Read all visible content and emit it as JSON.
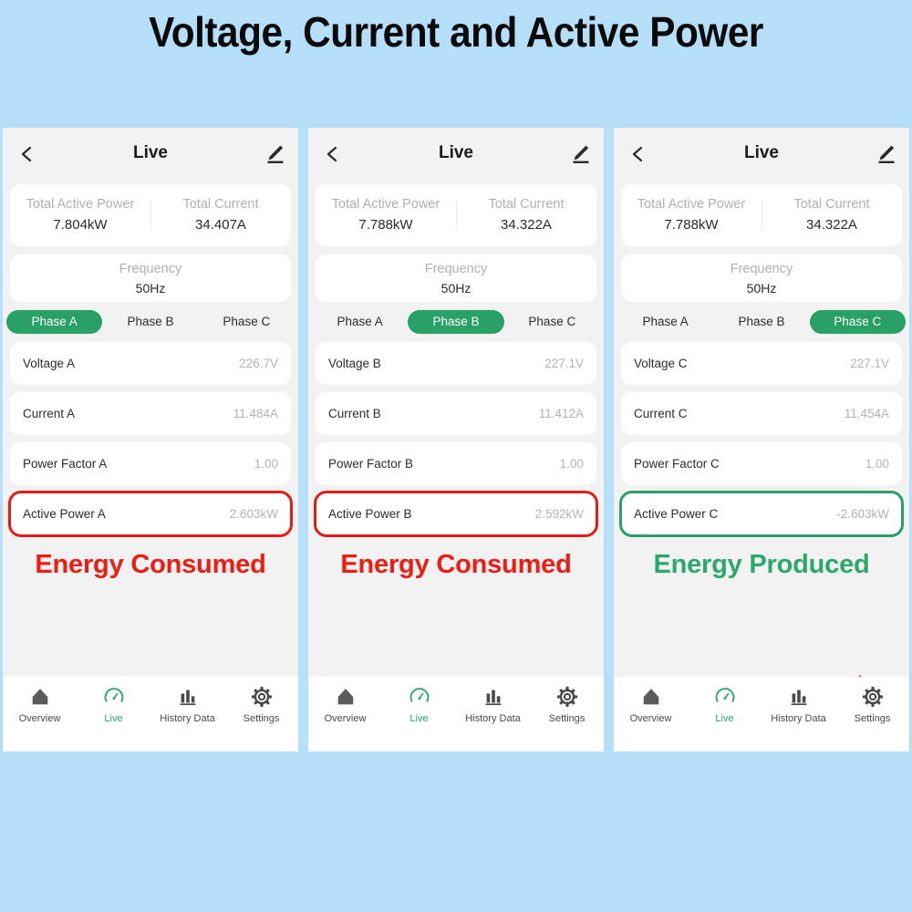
{
  "page": {
    "title": "Voltage, Current and Active Power",
    "background_color": "#b5dff8",
    "accent_green": "#28a066",
    "accent_red": "#e51b15"
  },
  "panels": [
    {
      "header": {
        "title": "Live",
        "back_icon": "chevron-left-icon",
        "edit_icon": "pencil-edit-icon"
      },
      "summary": {
        "total_active_power_label": "Total Active Power",
        "total_active_power_value": "7.804kW",
        "total_current_label": "Total Current",
        "total_current_value": "34.407A"
      },
      "frequency": {
        "label": "Frequency",
        "value": "50Hz"
      },
      "phase_tabs": [
        {
          "label": "Phase A",
          "active": true
        },
        {
          "label": "Phase B",
          "active": false
        },
        {
          "label": "Phase C",
          "active": false
        }
      ],
      "rows": [
        {
          "label": "Voltage A",
          "value": "226.7V",
          "highlight": "none"
        },
        {
          "label": "Current A",
          "value": "11.484A",
          "highlight": "none"
        },
        {
          "label": "Power Factor A",
          "value": "1.00",
          "highlight": "none"
        },
        {
          "label": "Active Power A",
          "value": "2.603kW",
          "highlight": "red"
        }
      ],
      "annotation": {
        "text": "Energy Consumed",
        "color": "red",
        "has_arrow": false
      }
    },
    {
      "header": {
        "title": "Live",
        "back_icon": "chevron-left-icon",
        "edit_icon": "pencil-edit-icon"
      },
      "summary": {
        "total_active_power_label": "Total Active Power",
        "total_active_power_value": "7.788kW",
        "total_current_label": "Total Current",
        "total_current_value": "34.322A"
      },
      "frequency": {
        "label": "Frequency",
        "value": "50Hz"
      },
      "phase_tabs": [
        {
          "label": "Phase A",
          "active": false
        },
        {
          "label": "Phase B",
          "active": true
        },
        {
          "label": "Phase C",
          "active": false
        }
      ],
      "rows": [
        {
          "label": "Voltage B",
          "value": "227.1V",
          "highlight": "none"
        },
        {
          "label": "Current B",
          "value": "11.412A",
          "highlight": "none"
        },
        {
          "label": "Power Factor B",
          "value": "1.00",
          "highlight": "none"
        },
        {
          "label": "Active Power B",
          "value": "2.592kW",
          "highlight": "red"
        }
      ],
      "annotation": {
        "text": "Energy Consumed",
        "color": "red",
        "has_arrow": false
      }
    },
    {
      "header": {
        "title": "Live",
        "back_icon": "chevron-left-icon",
        "edit_icon": "pencil-edit-icon"
      },
      "summary": {
        "total_active_power_label": "Total Active Power",
        "total_active_power_value": "7.788kW",
        "total_current_label": "Total Current",
        "total_current_value": "34.322A"
      },
      "frequency": {
        "label": "Frequency",
        "value": "50Hz"
      },
      "phase_tabs": [
        {
          "label": "Phase A",
          "active": false
        },
        {
          "label": "Phase B",
          "active": false
        },
        {
          "label": "Phase C",
          "active": true
        }
      ],
      "rows": [
        {
          "label": "Voltage C",
          "value": "227.1V",
          "highlight": "none"
        },
        {
          "label": "Current C",
          "value": "11.454A",
          "highlight": "none"
        },
        {
          "label": "Power Factor C",
          "value": "1.00",
          "highlight": "none"
        },
        {
          "label": "Active Power C",
          "value": "-2.603kW",
          "highlight": "green"
        }
      ],
      "annotation": {
        "text": "Energy Produced",
        "color": "green",
        "has_arrow": true
      }
    }
  ],
  "bottom_nav": [
    {
      "label": "Overview",
      "icon": "home-icon",
      "active": false
    },
    {
      "label": "Live",
      "icon": "gauge-icon",
      "active": true
    },
    {
      "label": "History Data",
      "icon": "bar-chart-icon",
      "active": false
    },
    {
      "label": "Settings",
      "icon": "gear-icon",
      "active": false
    }
  ]
}
